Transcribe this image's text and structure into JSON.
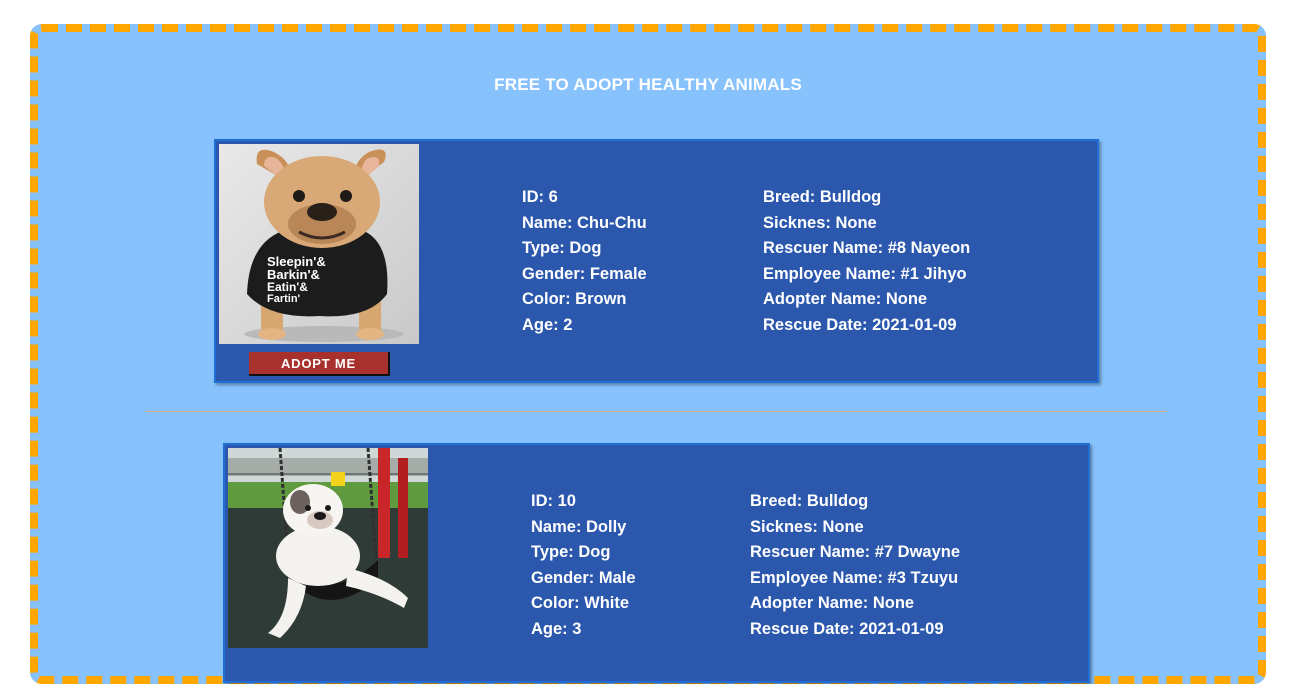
{
  "page": {
    "title": "FREE TO ADOPT HEALTHY ANIMALS"
  },
  "colors": {
    "background": "#87c2fc",
    "frame_border": "#ffa600",
    "card": "#2b57ad",
    "button": "#a8312e"
  },
  "animals": [
    {
      "photo_icon": "french-bulldog-photo",
      "adopt_label": "ADOPT ME",
      "left": [
        "ID: 6",
        "Name: Chu-Chu",
        "Type: Dog",
        "Gender: Female",
        "Color: Brown",
        "Age: 2"
      ],
      "right": [
        "Breed: Bulldog",
        "Sicknes: None",
        "Rescuer Name: #8 Nayeon",
        "Employee Name: #1 Jihyo",
        "Adopter Name: None",
        "Rescue Date: 2021-01-09"
      ],
      "shirt_text": "Sleepin'& Barkin'& Eatin'& Fartin'"
    },
    {
      "photo_icon": "bulldog-on-swing-photo",
      "left": [
        "ID: 10",
        "Name: Dolly",
        "Type: Dog",
        "Gender: Male",
        "Color: White",
        "Age: 3"
      ],
      "right": [
        "Breed: Bulldog",
        "Sicknes: None",
        "Rescuer Name: #7 Dwayne",
        "Employee Name: #3 Tzuyu",
        "Adopter Name: None",
        "Rescue Date: 2021-01-09"
      ]
    }
  ]
}
